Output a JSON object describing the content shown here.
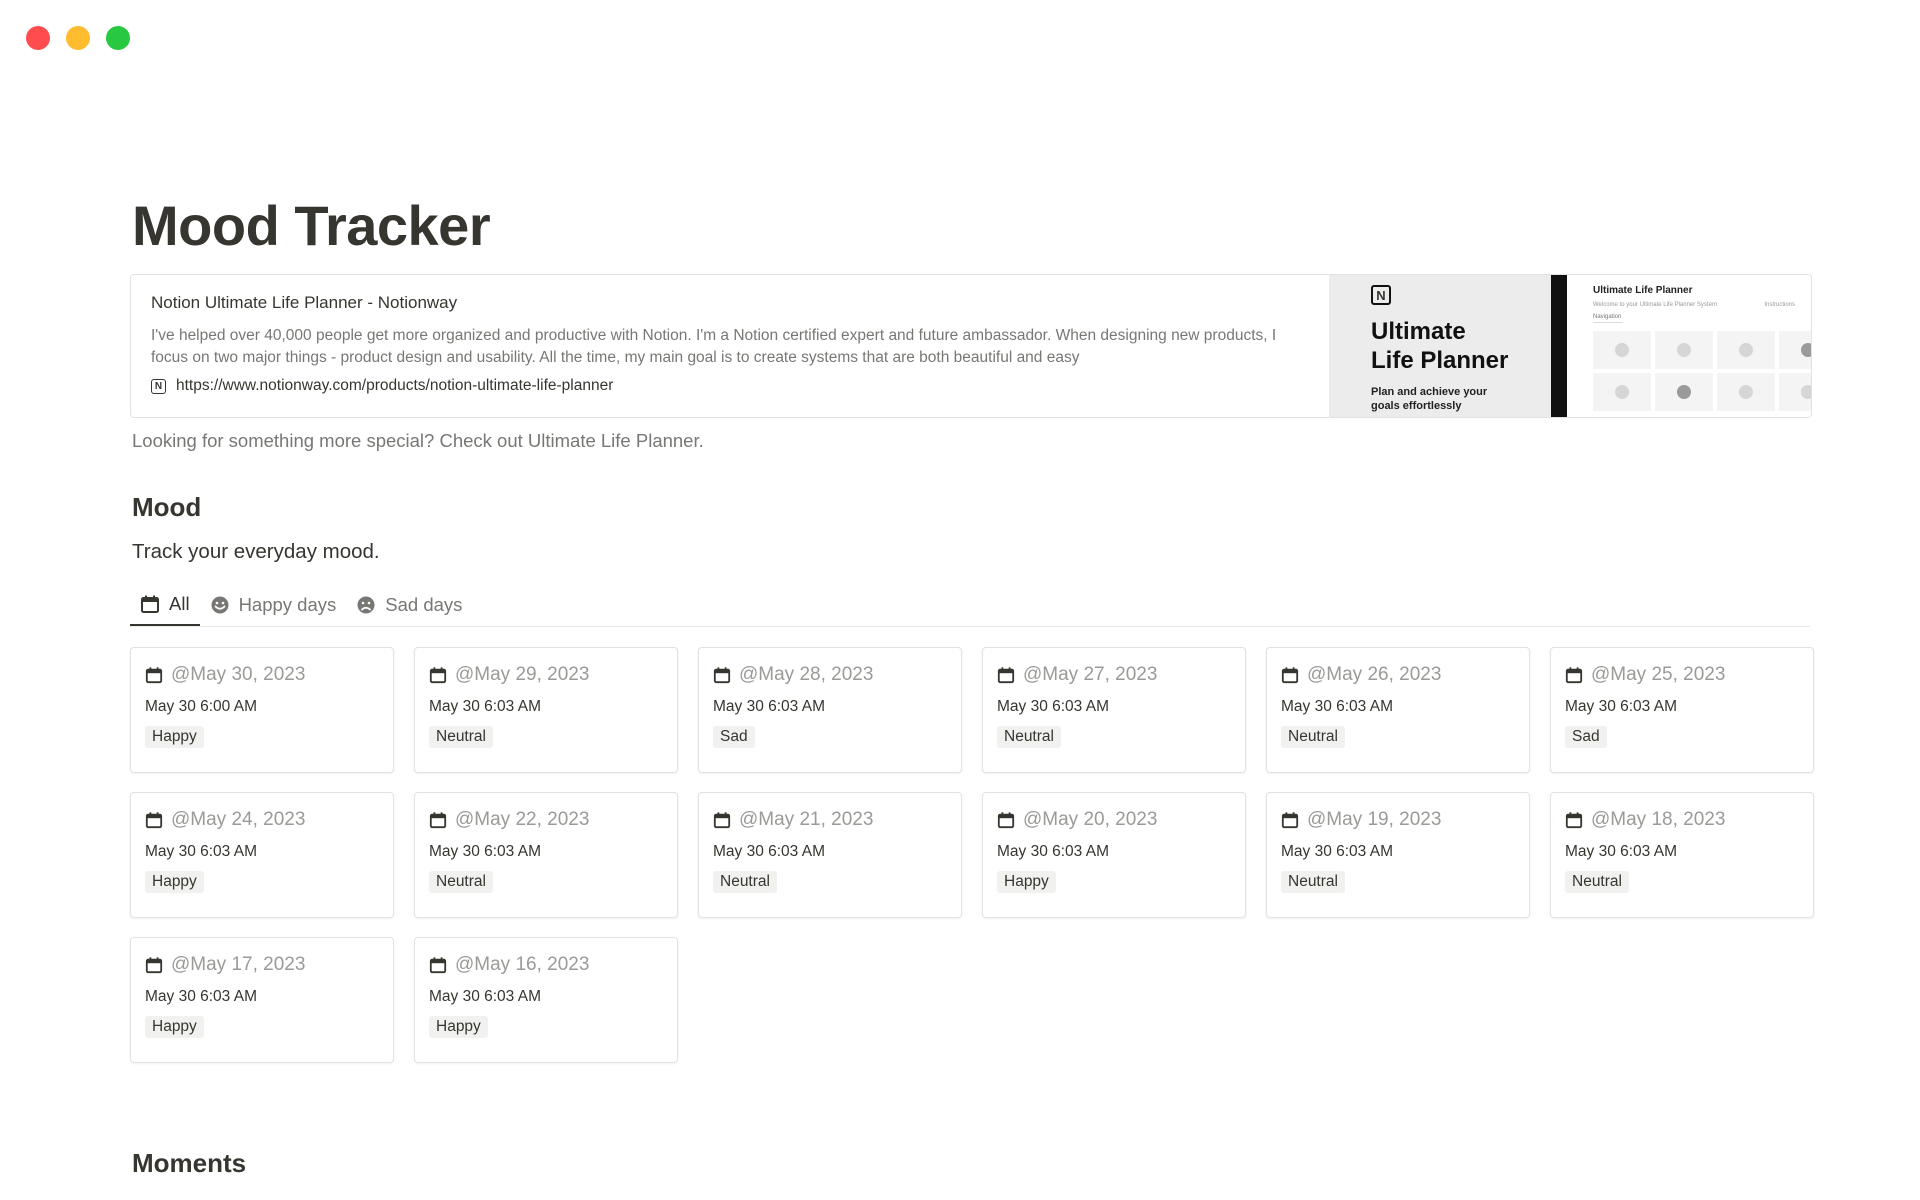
{
  "page": {
    "title": "Mood Tracker"
  },
  "bookmark": {
    "title": "Notion Ultimate Life Planner - Notionway",
    "description": "I've helped over 40,000 people get more organized and productive with Notion. I'm a Notion certified expert and future ambassador. When designing new products, I focus on two major things - product design and usability. All the time, my main goal is to create systems that are both beautiful and easy",
    "url": "https://www.notionway.com/products/notion-ultimate-life-planner",
    "thumbnail": {
      "heading": "Ultimate\nLife Planner",
      "subheading": "Plan and achieve your goals effortlessly",
      "preview_title": "Ultimate Life Planner",
      "preview_subtitle": "Welcome to your Ultimate Life Planner System",
      "preview_action": "Instructions",
      "preview_tab": "Navigation"
    }
  },
  "note": "Looking for something more special? Check out Ultimate Life Planner.",
  "mood_section": {
    "title": "Mood",
    "description": "Track your everyday mood.",
    "tabs": [
      {
        "label": "All",
        "icon": "calendar-icon",
        "active": true
      },
      {
        "label": "Happy days",
        "icon": "smile-icon",
        "active": false
      },
      {
        "label": "Sad days",
        "icon": "sad-face-icon",
        "active": false
      }
    ],
    "cards": [
      {
        "date": "@May 30, 2023",
        "time": "May 30 6:00 AM",
        "mood": "Happy"
      },
      {
        "date": "@May 29, 2023",
        "time": "May 30 6:03 AM",
        "mood": "Neutral"
      },
      {
        "date": "@May 28, 2023",
        "time": "May 30 6:03 AM",
        "mood": "Sad"
      },
      {
        "date": "@May 27, 2023",
        "time": "May 30 6:03 AM",
        "mood": "Neutral"
      },
      {
        "date": "@May 26, 2023",
        "time": "May 30 6:03 AM",
        "mood": "Neutral"
      },
      {
        "date": "@May 25, 2023",
        "time": "May 30 6:03 AM",
        "mood": "Sad"
      },
      {
        "date": "@May 24, 2023",
        "time": "May 30 6:03 AM",
        "mood": "Happy"
      },
      {
        "date": "@May 22, 2023",
        "time": "May 30 6:03 AM",
        "mood": "Neutral"
      },
      {
        "date": "@May 21, 2023",
        "time": "May 30 6:03 AM",
        "mood": "Neutral"
      },
      {
        "date": "@May 20, 2023",
        "time": "May 30 6:03 AM",
        "mood": "Happy"
      },
      {
        "date": "@May 19, 2023",
        "time": "May 30 6:03 AM",
        "mood": "Neutral"
      },
      {
        "date": "@May 18, 2023",
        "time": "May 30 6:03 AM",
        "mood": "Neutral"
      },
      {
        "date": "@May 17, 2023",
        "time": "May 30 6:03 AM",
        "mood": "Happy"
      },
      {
        "date": "@May 16, 2023",
        "time": "May 30 6:03 AM",
        "mood": "Happy"
      }
    ]
  },
  "moments_section": {
    "title": "Moments"
  },
  "colors": {
    "text": "#37352f",
    "muted": "#787774",
    "tag_bg": "#f1f1ef",
    "border": "#e3e2df"
  }
}
